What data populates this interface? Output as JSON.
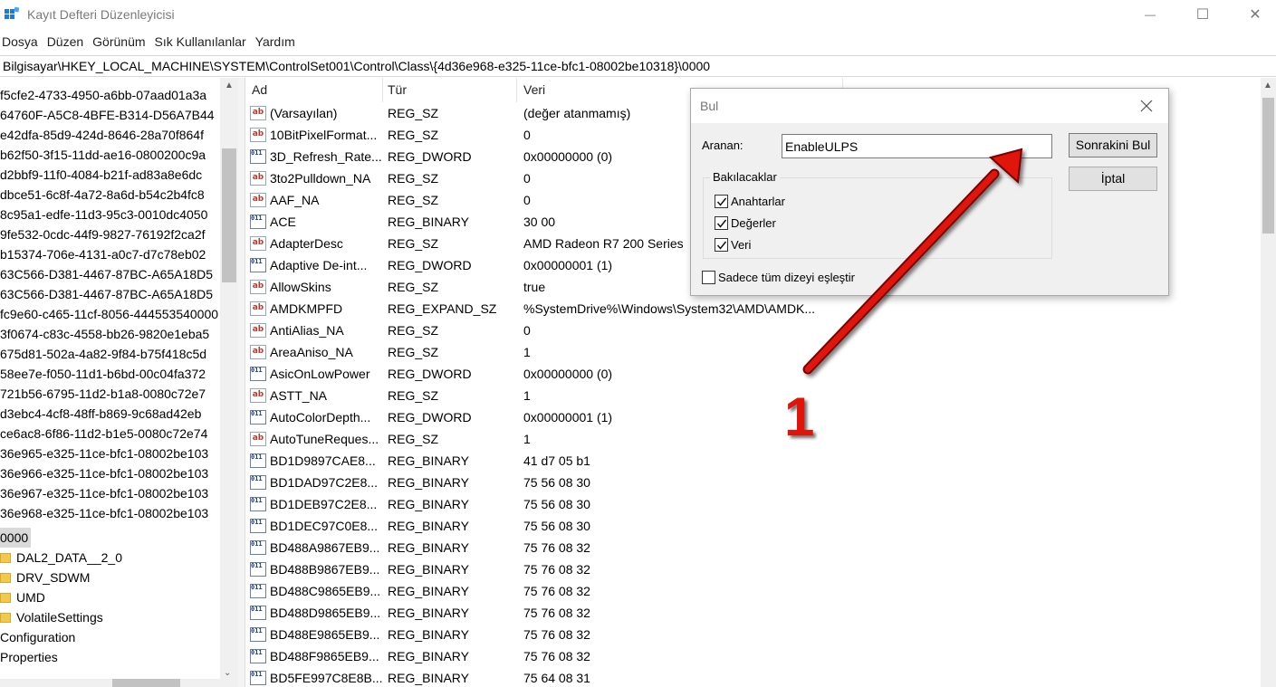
{
  "window": {
    "title": "Kayıt Defteri Düzenleyicisi",
    "minimize_glyph": "—",
    "maximize_glyph": "☐",
    "close_glyph": "✕"
  },
  "menu": [
    "Dosya",
    "Düzen",
    "Görünüm",
    "Sık Kullanılanlar",
    "Yardım"
  ],
  "address": "Bilgisayar\\HKEY_LOCAL_MACHINE\\SYSTEM\\ControlSet001\\Control\\Class\\{4d36e968-e325-11ce-bfc1-08002be10318}\\0000",
  "tree": [
    {
      "label": "f5cfe2-4733-4950-a6bb-07aad01a3a",
      "icon": "none"
    },
    {
      "label": "64760F-A5C8-4BFE-B314-D56A7B44",
      "icon": "none"
    },
    {
      "label": "e42dfa-85d9-424d-8646-28a70f864f",
      "icon": "none"
    },
    {
      "label": "b62f50-3f15-11dd-ae16-0800200c9a",
      "icon": "none"
    },
    {
      "label": "d2bbf9-11f0-4084-b21f-ad83a8e6dc",
      "icon": "none"
    },
    {
      "label": "dbce51-6c8f-4a72-8a6d-b54c2b4fc8",
      "icon": "none"
    },
    {
      "label": "8c95a1-edfe-11d3-95c3-0010dc4050",
      "icon": "none"
    },
    {
      "label": "9fe532-0cdc-44f9-9827-76192f2ca2f",
      "icon": "none"
    },
    {
      "label": "b15374-706e-4131-a0c7-d7c78eb02",
      "icon": "none"
    },
    {
      "label": "63C566-D381-4467-87BC-A65A18D5",
      "icon": "none"
    },
    {
      "label": "63C566-D381-4467-87BC-A65A18D5",
      "icon": "none"
    },
    {
      "label": "fc9e60-c465-11cf-8056-444553540000",
      "icon": "none"
    },
    {
      "label": "3f0674-c83c-4558-bb26-9820e1eba5",
      "icon": "none"
    },
    {
      "label": "675d81-502a-4a82-9f84-b75f418c5d",
      "icon": "none"
    },
    {
      "label": "58ee7e-f050-11d1-b6bd-00c04fa372",
      "icon": "none"
    },
    {
      "label": "721b56-6795-11d2-b1a8-0080c72e7",
      "icon": "none"
    },
    {
      "label": "d3ebc4-4cf8-48ff-b869-9c68ad42eb",
      "icon": "none"
    },
    {
      "label": "ce6ac8-6f86-11d2-b1e5-0080c72e74",
      "icon": "none"
    },
    {
      "label": "36e965-e325-11ce-bfc1-08002be103",
      "icon": "none"
    },
    {
      "label": "36e966-e325-11ce-bfc1-08002be103",
      "icon": "none"
    },
    {
      "label": "36e967-e325-11ce-bfc1-08002be103",
      "icon": "none"
    },
    {
      "label": "36e968-e325-11ce-bfc1-08002be103",
      "icon": "none"
    },
    {
      "label": "0000",
      "icon": "none",
      "selected": true
    },
    {
      "label": "DAL2_DATA__2_0",
      "icon": "folder-icon"
    },
    {
      "label": "DRV_SDWM",
      "icon": "folder-icon"
    },
    {
      "label": "UMD",
      "icon": "folder-icon"
    },
    {
      "label": "VolatileSettings",
      "icon": "folder-icon"
    },
    {
      "label": "Configuration",
      "icon": "none"
    },
    {
      "label": "Properties",
      "icon": "none"
    }
  ],
  "columns": {
    "name": "Ad",
    "type": "Tür",
    "data": "Veri"
  },
  "values": [
    {
      "name": "(Varsayılan)",
      "type": "REG_SZ",
      "data": "(değer atanmamış)",
      "icon": "string-value-icon"
    },
    {
      "name": "10BitPixelFormat...",
      "type": "REG_SZ",
      "data": "0",
      "icon": "string-value-icon"
    },
    {
      "name": "3D_Refresh_Rate...",
      "type": "REG_DWORD",
      "data": "0x00000000 (0)",
      "icon": "binary-value-icon"
    },
    {
      "name": "3to2Pulldown_NA",
      "type": "REG_SZ",
      "data": "0",
      "icon": "string-value-icon"
    },
    {
      "name": "AAF_NA",
      "type": "REG_SZ",
      "data": "0",
      "icon": "string-value-icon"
    },
    {
      "name": "ACE",
      "type": "REG_BINARY",
      "data": "30 00",
      "icon": "binary-value-icon"
    },
    {
      "name": "AdapterDesc",
      "type": "REG_SZ",
      "data": "AMD Radeon R7 200 Series",
      "icon": "string-value-icon"
    },
    {
      "name": "Adaptive De-int...",
      "type": "REG_DWORD",
      "data": "0x00000001 (1)",
      "icon": "binary-value-icon"
    },
    {
      "name": "AllowSkins",
      "type": "REG_SZ",
      "data": "true",
      "icon": "string-value-icon"
    },
    {
      "name": "AMDKMPFD",
      "type": "REG_EXPAND_SZ",
      "data": "%SystemDrive%\\Windows\\System32\\AMD\\AMDK...",
      "icon": "string-value-icon"
    },
    {
      "name": "AntiAlias_NA",
      "type": "REG_SZ",
      "data": "0",
      "icon": "string-value-icon"
    },
    {
      "name": "AreaAniso_NA",
      "type": "REG_SZ",
      "data": "1",
      "icon": "string-value-icon"
    },
    {
      "name": "AsicOnLowPower",
      "type": "REG_DWORD",
      "data": "0x00000000 (0)",
      "icon": "binary-value-icon"
    },
    {
      "name": "ASTT_NA",
      "type": "REG_SZ",
      "data": "1",
      "icon": "string-value-icon"
    },
    {
      "name": "AutoColorDepth...",
      "type": "REG_DWORD",
      "data": "0x00000001 (1)",
      "icon": "binary-value-icon"
    },
    {
      "name": "AutoTuneReques...",
      "type": "REG_SZ",
      "data": "1",
      "icon": "string-value-icon"
    },
    {
      "name": "BD1D9897CAE8...",
      "type": "REG_BINARY",
      "data": "41 d7 05 b1",
      "icon": "binary-value-icon"
    },
    {
      "name": "BD1DAD97C2E8...",
      "type": "REG_BINARY",
      "data": "75 56 08 30",
      "icon": "binary-value-icon"
    },
    {
      "name": "BD1DEB97C2E8...",
      "type": "REG_BINARY",
      "data": "75 56 08 30",
      "icon": "binary-value-icon"
    },
    {
      "name": "BD1DEC97C0E8...",
      "type": "REG_BINARY",
      "data": "75 56 08 30",
      "icon": "binary-value-icon"
    },
    {
      "name": "BD488A9867EB9...",
      "type": "REG_BINARY",
      "data": "75 76 08 32",
      "icon": "binary-value-icon"
    },
    {
      "name": "BD488B9867EB9...",
      "type": "REG_BINARY",
      "data": "75 76 08 32",
      "icon": "binary-value-icon"
    },
    {
      "name": "BD488C9865EB9...",
      "type": "REG_BINARY",
      "data": "75 76 08 32",
      "icon": "binary-value-icon"
    },
    {
      "name": "BD488D9865EB9...",
      "type": "REG_BINARY",
      "data": "75 76 08 32",
      "icon": "binary-value-icon"
    },
    {
      "name": "BD488E9865EB9...",
      "type": "REG_BINARY",
      "data": "75 76 08 32",
      "icon": "binary-value-icon"
    },
    {
      "name": "BD488F9865EB9...",
      "type": "REG_BINARY",
      "data": "75 76 08 32",
      "icon": "binary-value-icon"
    },
    {
      "name": "BD5FE997C8E8B...",
      "type": "REG_BINARY",
      "data": "75 64 08 31",
      "icon": "binary-value-icon"
    }
  ],
  "find_dialog": {
    "title": "Bul",
    "search_label": "Aranan:",
    "search_value": "EnableULPS",
    "find_next_label": "Sonrakini Bul",
    "cancel_label": "İptal",
    "group_title": "Bakılacaklar",
    "options": [
      {
        "label": "Anahtarlar",
        "checked": true
      },
      {
        "label": "Değerler",
        "checked": true
      },
      {
        "label": "Veri",
        "checked": true
      }
    ],
    "match_whole_label": "Sadece tüm dizeyi eşleştir",
    "match_whole_checked": false
  },
  "annotation": {
    "number": "1",
    "color": "#e0140a"
  }
}
